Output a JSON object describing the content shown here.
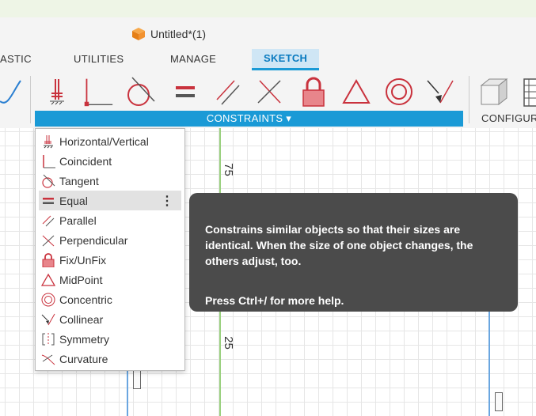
{
  "window": {
    "title": "Untitled*(1)"
  },
  "tabs": [
    {
      "label": "ASTIC"
    },
    {
      "label": "UTILITIES"
    },
    {
      "label": "MANAGE"
    },
    {
      "label": "SKETCH"
    }
  ],
  "toolbar": {
    "constraints_label": "CONSTRAINTS ▾",
    "configure_label": "CONFIGUR"
  },
  "menu": {
    "items": [
      {
        "label": "Horizontal/Vertical",
        "icon": "horizontal-vertical-icon"
      },
      {
        "label": "Coincident",
        "icon": "coincident-icon"
      },
      {
        "label": "Tangent",
        "icon": "tangent-icon"
      },
      {
        "label": "Equal",
        "icon": "equal-icon"
      },
      {
        "label": "Parallel",
        "icon": "parallel-icon"
      },
      {
        "label": "Perpendicular",
        "icon": "perpendicular-icon"
      },
      {
        "label": "Fix/UnFix",
        "icon": "lock-icon"
      },
      {
        "label": "MidPoint",
        "icon": "midpoint-icon"
      },
      {
        "label": "Concentric",
        "icon": "concentric-icon"
      },
      {
        "label": "Collinear",
        "icon": "collinear-icon"
      },
      {
        "label": "Symmetry",
        "icon": "symmetry-icon"
      },
      {
        "label": "Curvature",
        "icon": "curvature-icon"
      }
    ],
    "more_label": "⋮"
  },
  "tooltip": {
    "line1": "Constrains similar objects so that their sizes are",
    "line2": "identical. When the size of one object changes, the",
    "line3": "others adjust, too.",
    "help": "Press Ctrl+/ for more help."
  },
  "canvas": {
    "ruler_top": "75",
    "ruler_bottom": "25"
  },
  "colors": {
    "accent": "#1a9ad6",
    "constraint_red": "#c9323d"
  }
}
